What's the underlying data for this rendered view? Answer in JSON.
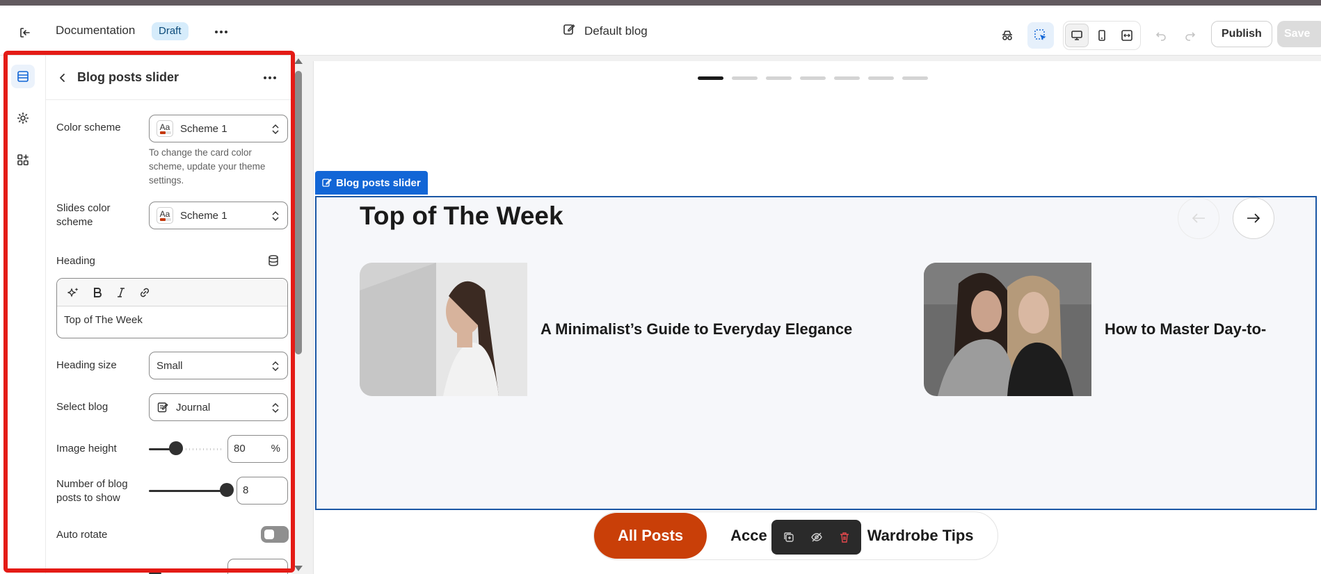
{
  "topbar": {
    "title": "Documentation",
    "status_badge": "Draft",
    "page_name": "Default blog",
    "publish_label": "Publish",
    "save_label": "Save",
    "icons": [
      "exit-icon",
      "more-icon",
      "page-edit-icon",
      "incognito-icon",
      "inspector-icon",
      "desktop-icon",
      "mobile-icon",
      "fullwidth-icon",
      "undo-icon",
      "redo-icon"
    ]
  },
  "rail": {
    "items": [
      {
        "name": "sections-icon",
        "active": true
      },
      {
        "name": "theme-settings-icon",
        "active": false
      },
      {
        "name": "apps-icon",
        "active": false
      }
    ]
  },
  "panel": {
    "title": "Blog posts slider",
    "color_scheme": {
      "label": "Color scheme",
      "value": "Scheme 1",
      "swatch_text": "Aa"
    },
    "help_text": "To change the card color scheme, update your theme settings.",
    "slides_color_scheme": {
      "label": "Slides color scheme",
      "value": "Scheme 1",
      "swatch_text": "Aa"
    },
    "heading": {
      "label": "Heading",
      "value": "Top of The Week"
    },
    "heading_size": {
      "label": "Heading size",
      "value": "Small"
    },
    "select_blog": {
      "label": "Select blog",
      "value": "Journal"
    },
    "image_height": {
      "label": "Image height",
      "value": "80",
      "unit": "%",
      "fraction": 0.4
    },
    "posts_to_show": {
      "label": "Number of blog posts to show",
      "value": "8",
      "fraction": 1.0
    },
    "auto_rotate": {
      "label": "Auto rotate",
      "on": false
    }
  },
  "preview": {
    "section_tag": "Blog posts slider",
    "heading": "Top of The Week",
    "pagination": {
      "count": 7,
      "active": 0
    },
    "cards": [
      {
        "title": "A Minimalist’s Guide to Everyday Elegance"
      },
      {
        "title": "How to Master Day-to-"
      }
    ],
    "tabs": [
      {
        "label": "All Posts",
        "active": true
      },
      {
        "label": "Acce",
        "active": false
      },
      {
        "label": "Wardrobe Tips",
        "active": false
      }
    ],
    "colors": {
      "accent": "#c93f08",
      "selection": "#1266d6",
      "highlight": "#e41b16"
    }
  }
}
